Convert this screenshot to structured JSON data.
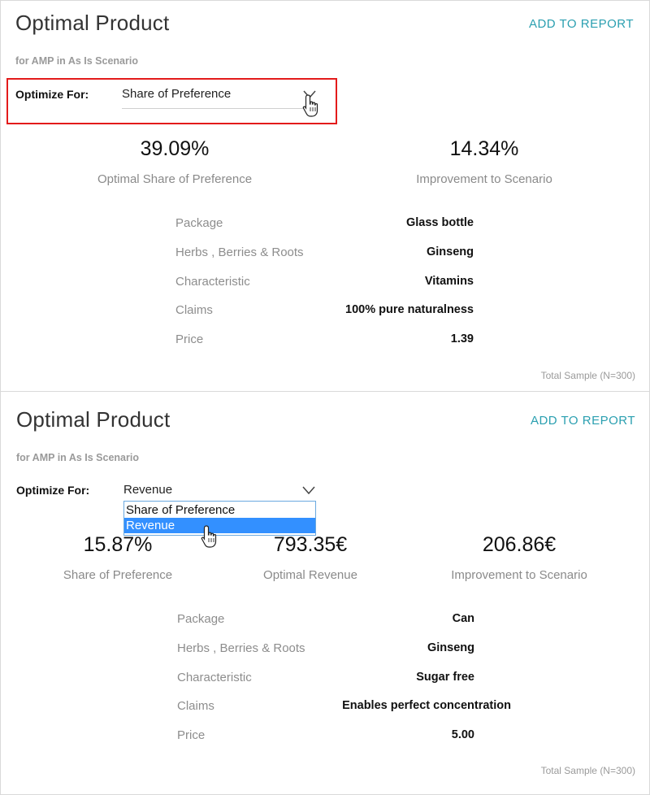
{
  "panels": [
    {
      "title": "Optimal Product",
      "add_to_report": "ADD TO REPORT",
      "subtitle": "for AMP in As Is Scenario",
      "optimize_label": "Optimize For:",
      "optimize_value": "Share of Preference",
      "metrics": [
        {
          "value": "39.09%",
          "label": "Optimal Share of Preference"
        },
        {
          "value": "14.34%",
          "label": "Improvement to Scenario"
        }
      ],
      "attributes": [
        {
          "name": "Package",
          "value": "Glass bottle"
        },
        {
          "name": "Herbs , Berries & Roots",
          "value": "Ginseng"
        },
        {
          "name": "Characteristic",
          "value": "Vitamins"
        },
        {
          "name": "Claims",
          "value": "100% pure naturalness"
        },
        {
          "name": "Price",
          "value": "1.39"
        }
      ],
      "sample": "Total Sample (N=300)"
    },
    {
      "title": "Optimal Product",
      "add_to_report": "ADD TO REPORT",
      "subtitle": "for AMP in As Is Scenario",
      "optimize_label": "Optimize For:",
      "optimize_value": "Revenue",
      "dropdown_options": [
        "Share of Preference",
        "Revenue"
      ],
      "dropdown_selected": "Revenue",
      "metrics": [
        {
          "value": "15.87%",
          "label": "Share of Preference"
        },
        {
          "value": "793.35€",
          "label": "Optimal Revenue"
        },
        {
          "value": "206.86€",
          "label": "Improvement to Scenario"
        }
      ],
      "attributes": [
        {
          "name": "Package",
          "value": "Can"
        },
        {
          "name": "Herbs , Berries & Roots",
          "value": "Ginseng"
        },
        {
          "name": "Characteristic",
          "value": "Sugar free"
        },
        {
          "name": "Claims",
          "value": "Enables perfect concentration"
        },
        {
          "name": "Price",
          "value": "5.00"
        }
      ],
      "sample": "Total Sample (N=300)"
    }
  ],
  "colors": {
    "accent": "#2a9fb0",
    "highlight_frame": "#e31b1b",
    "dropdown_selected": "#3390ff"
  }
}
